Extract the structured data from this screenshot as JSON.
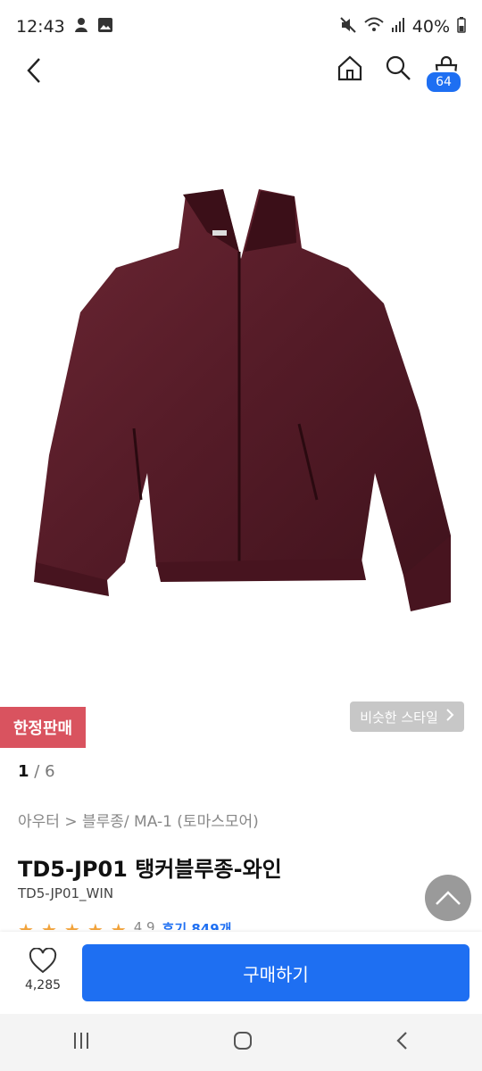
{
  "status": {
    "time": "12:43",
    "battery": "40%",
    "icons": [
      "emoji-notification-icon",
      "gallery-notification-icon",
      "mute-icon",
      "wifi-icon",
      "signal-icon",
      "battery-icon"
    ]
  },
  "header": {
    "cart_count": "64",
    "icons": [
      "back-icon",
      "home-icon",
      "search-icon",
      "cart-icon"
    ]
  },
  "product": {
    "limited_label": "한정판매",
    "similar_label": "비슷한 스타일",
    "page_current": "1",
    "page_total": "6",
    "breadcrumb": "아우터 > 블루종/ MA-1 (토마스모어)",
    "title": "TD5-JP01 탱커블루종-와인",
    "code": "TD5-JP01_WIN",
    "rating_partial": "4.9",
    "reviews_partial": "후기 849개"
  },
  "bottom": {
    "likes": "4,285",
    "buy_label": "구매하기"
  },
  "colors": {
    "accent": "#1e6ff2",
    "limited": "#d9535f",
    "jacket": "#5b1f2a"
  }
}
